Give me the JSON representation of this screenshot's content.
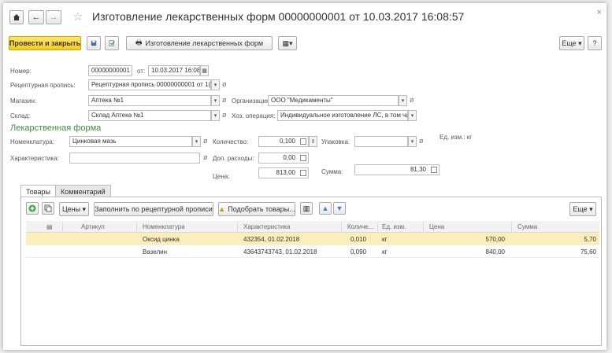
{
  "window": {
    "title": "Изготовление лекарственных форм 00000000001 от 10.03.2017 16:08:57",
    "close_glyph": "×"
  },
  "nav": {
    "home_icon": "home-icon",
    "back_glyph": "←",
    "forward_glyph": "→",
    "star_glyph": "☆"
  },
  "cmd": {
    "post_close": "Провести и закрыть",
    "print_form_label": "Изготовление лекарственных форм",
    "more_label": "Еще",
    "help_label": "?"
  },
  "header": {
    "number_label": "Номер:",
    "number_value": "00000000001",
    "date_from_label": "от:",
    "date_value": "10.03.2017 16:08:57",
    "prescription_label": "Рецептурная пропись:",
    "prescription_value": "Рецептурная пропись 00000000001 от 1(",
    "store_label": "Магазин:",
    "store_value": "Аптека №1",
    "org_label": "Организация:",
    "org_value": "ООО \"Медикаменты\"",
    "warehouse_label": "Склад:",
    "warehouse_value": "Склад Аптека №1",
    "operation_label": "Хоз. операция:",
    "operation_value": "Индивидуальное изготовление ЛС, в том чи"
  },
  "drug_form": {
    "section_title": "Лекарственная форма",
    "nomenclature_label": "Номенклатура:",
    "nomenclature_value": "Цинковая мазь",
    "quantity_label": "Количество:",
    "quantity_value": "0,100",
    "package_label": "Упаковка:",
    "package_value": "",
    "unit_label": "Ед. изм.: кг",
    "characteristic_label": "Характеристика:",
    "characteristic_value": "",
    "extra_costs_label": "Доп. расходы:",
    "extra_costs_value": "0,00",
    "price_label": "Цена:",
    "price_value": "813,00",
    "sum_label": "Сумма:",
    "sum_value": "81,30"
  },
  "tabs": [
    {
      "label": "Товары"
    },
    {
      "label": "Комментарий"
    }
  ],
  "table_toolbar": {
    "prices_label": "Цены",
    "fill_label": "Заполнить по рецептурной прописи",
    "pick_label": "Подобрать товары...",
    "more_label": "Еще"
  },
  "table": {
    "columns": [
      "Артикул",
      "Номенклатура",
      "Характеристика",
      "Количе...",
      "Ед. изм.",
      "Цена",
      "Сумма"
    ],
    "rows": [
      {
        "article": "",
        "nomenclature": "Оксид цинка",
        "characteristic": "432354, 01.02.2018",
        "quantity": "0,010",
        "unit": "кг",
        "price": "570,00",
        "sum": "5,70"
      },
      {
        "article": "",
        "nomenclature": "Вазелин",
        "characteristic": "43643743743, 01.02.2018",
        "quantity": "0,090",
        "unit": "кг",
        "price": "840,00",
        "sum": "75,60"
      }
    ]
  },
  "colors": {
    "primary_button": "#f6cc1f",
    "section_title": "#3b8f3b",
    "selected_row": "#fbeeb8"
  }
}
